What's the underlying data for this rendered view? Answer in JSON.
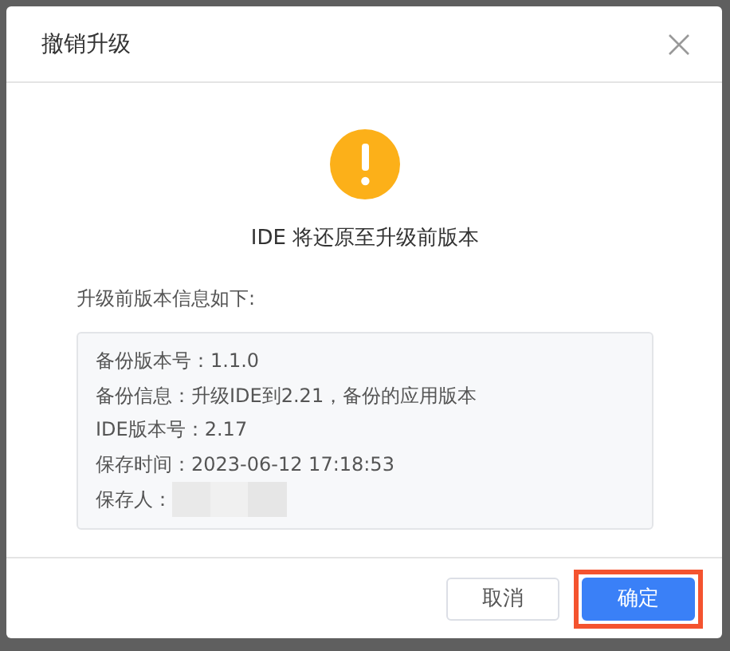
{
  "dialog": {
    "title": "撤销升级",
    "close_icon": true,
    "message": "IDE 将还原至升级前版本",
    "info_label": "升级前版本信息如下:",
    "info_lines": [
      {
        "label": "备份版本号：",
        "value": "1.1.0",
        "redacted": false
      },
      {
        "label": "备份信息：",
        "value": "升级IDE到2.21，备份的应用版本",
        "redacted": false
      },
      {
        "label": "IDE版本号：",
        "value": "2.17",
        "redacted": false
      },
      {
        "label": "保存时间：",
        "value": "2023-06-12 17:18:53",
        "redacted": false
      },
      {
        "label": "保存人：",
        "redacted": true
      }
    ],
    "buttons": [
      {
        "label": "取消",
        "kind": "secondary",
        "highlighted": false
      },
      {
        "label": "确定",
        "kind": "primary",
        "highlighted": true
      }
    ]
  }
}
